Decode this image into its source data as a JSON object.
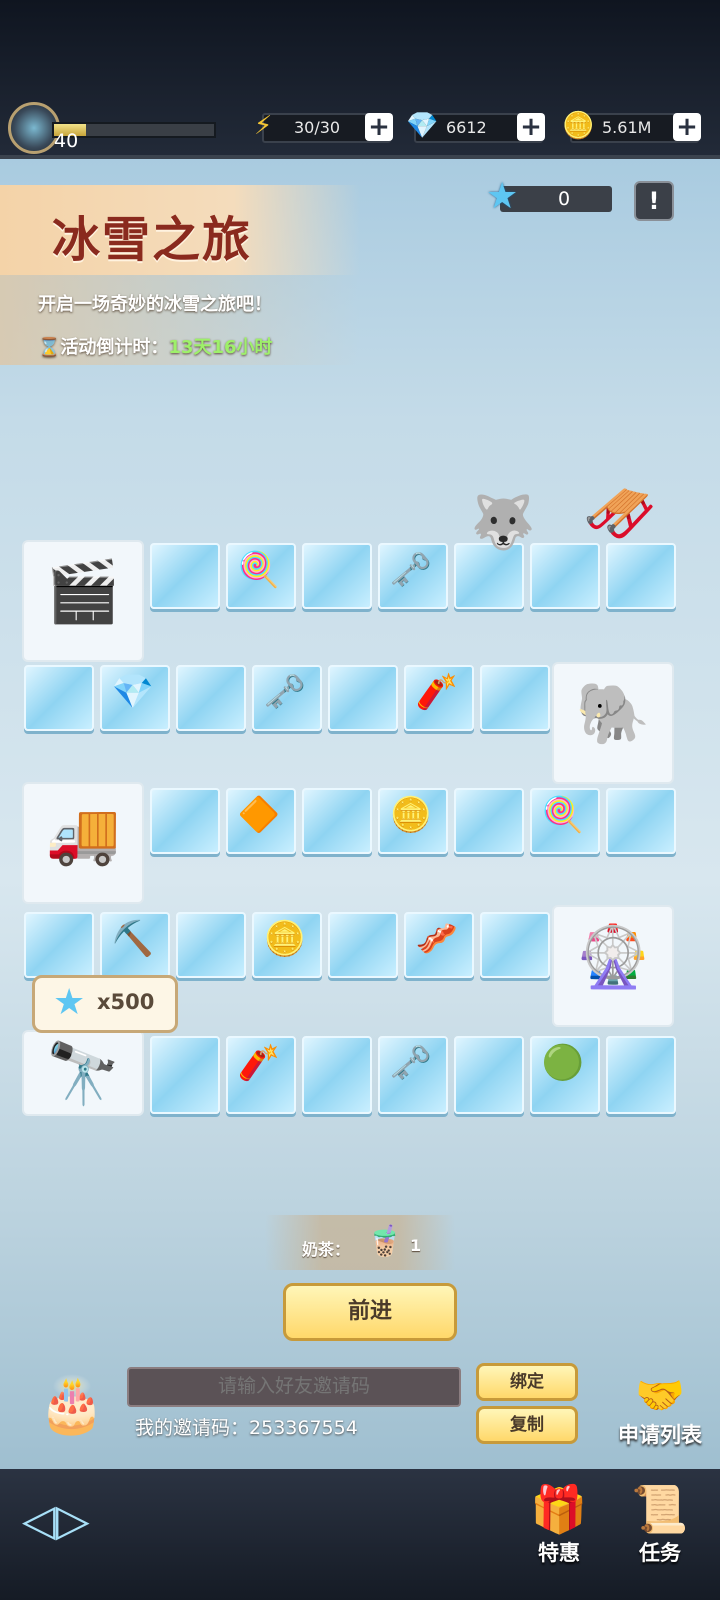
{
  "player": {
    "level": "40",
    "xp_fraction": 0.2
  },
  "resources": [
    {
      "icon": "lightning-icon",
      "glyph": "⚡",
      "value": "30/30"
    },
    {
      "icon": "diamond-icon",
      "glyph": "💎",
      "value": "6612"
    },
    {
      "icon": "coin-icon",
      "glyph": "🪙",
      "value": "5.61M"
    }
  ],
  "event": {
    "title": "冰雪之旅",
    "subtitle": "开启一场奇妙的冰雪之旅吧！",
    "countdown_label": "活动倒计时：",
    "countdown_value": "13天16小时"
  },
  "star_score": "0",
  "info_button": "!",
  "reward_bubble": {
    "text": "x500"
  },
  "board_items": {
    "lollipop": "🍭",
    "key": "🗝️",
    "gem": "💎",
    "tnt": "🧨",
    "gold": "🔶",
    "coin": "🪙",
    "pickaxe": "⛏️",
    "bacon": "🥓",
    "emerald": "🟢"
  },
  "buildings": {
    "cinema": "🎬",
    "elephant": "🐘",
    "cafe": "🚚",
    "ferris": "🎡",
    "observatory": "🔭"
  },
  "milk_tea": {
    "label": "奶茶：",
    "count": "1"
  },
  "advance_button": "前进",
  "invite": {
    "placeholder": "请输入好友邀请码",
    "my_code_label": "我的邀请码：",
    "my_code": "253367554",
    "bind_button": "绑定",
    "copy_button": "复制",
    "apply_list": "申请列表"
  },
  "nav": {
    "special_offer": "特惠",
    "tasks": "任务"
  }
}
